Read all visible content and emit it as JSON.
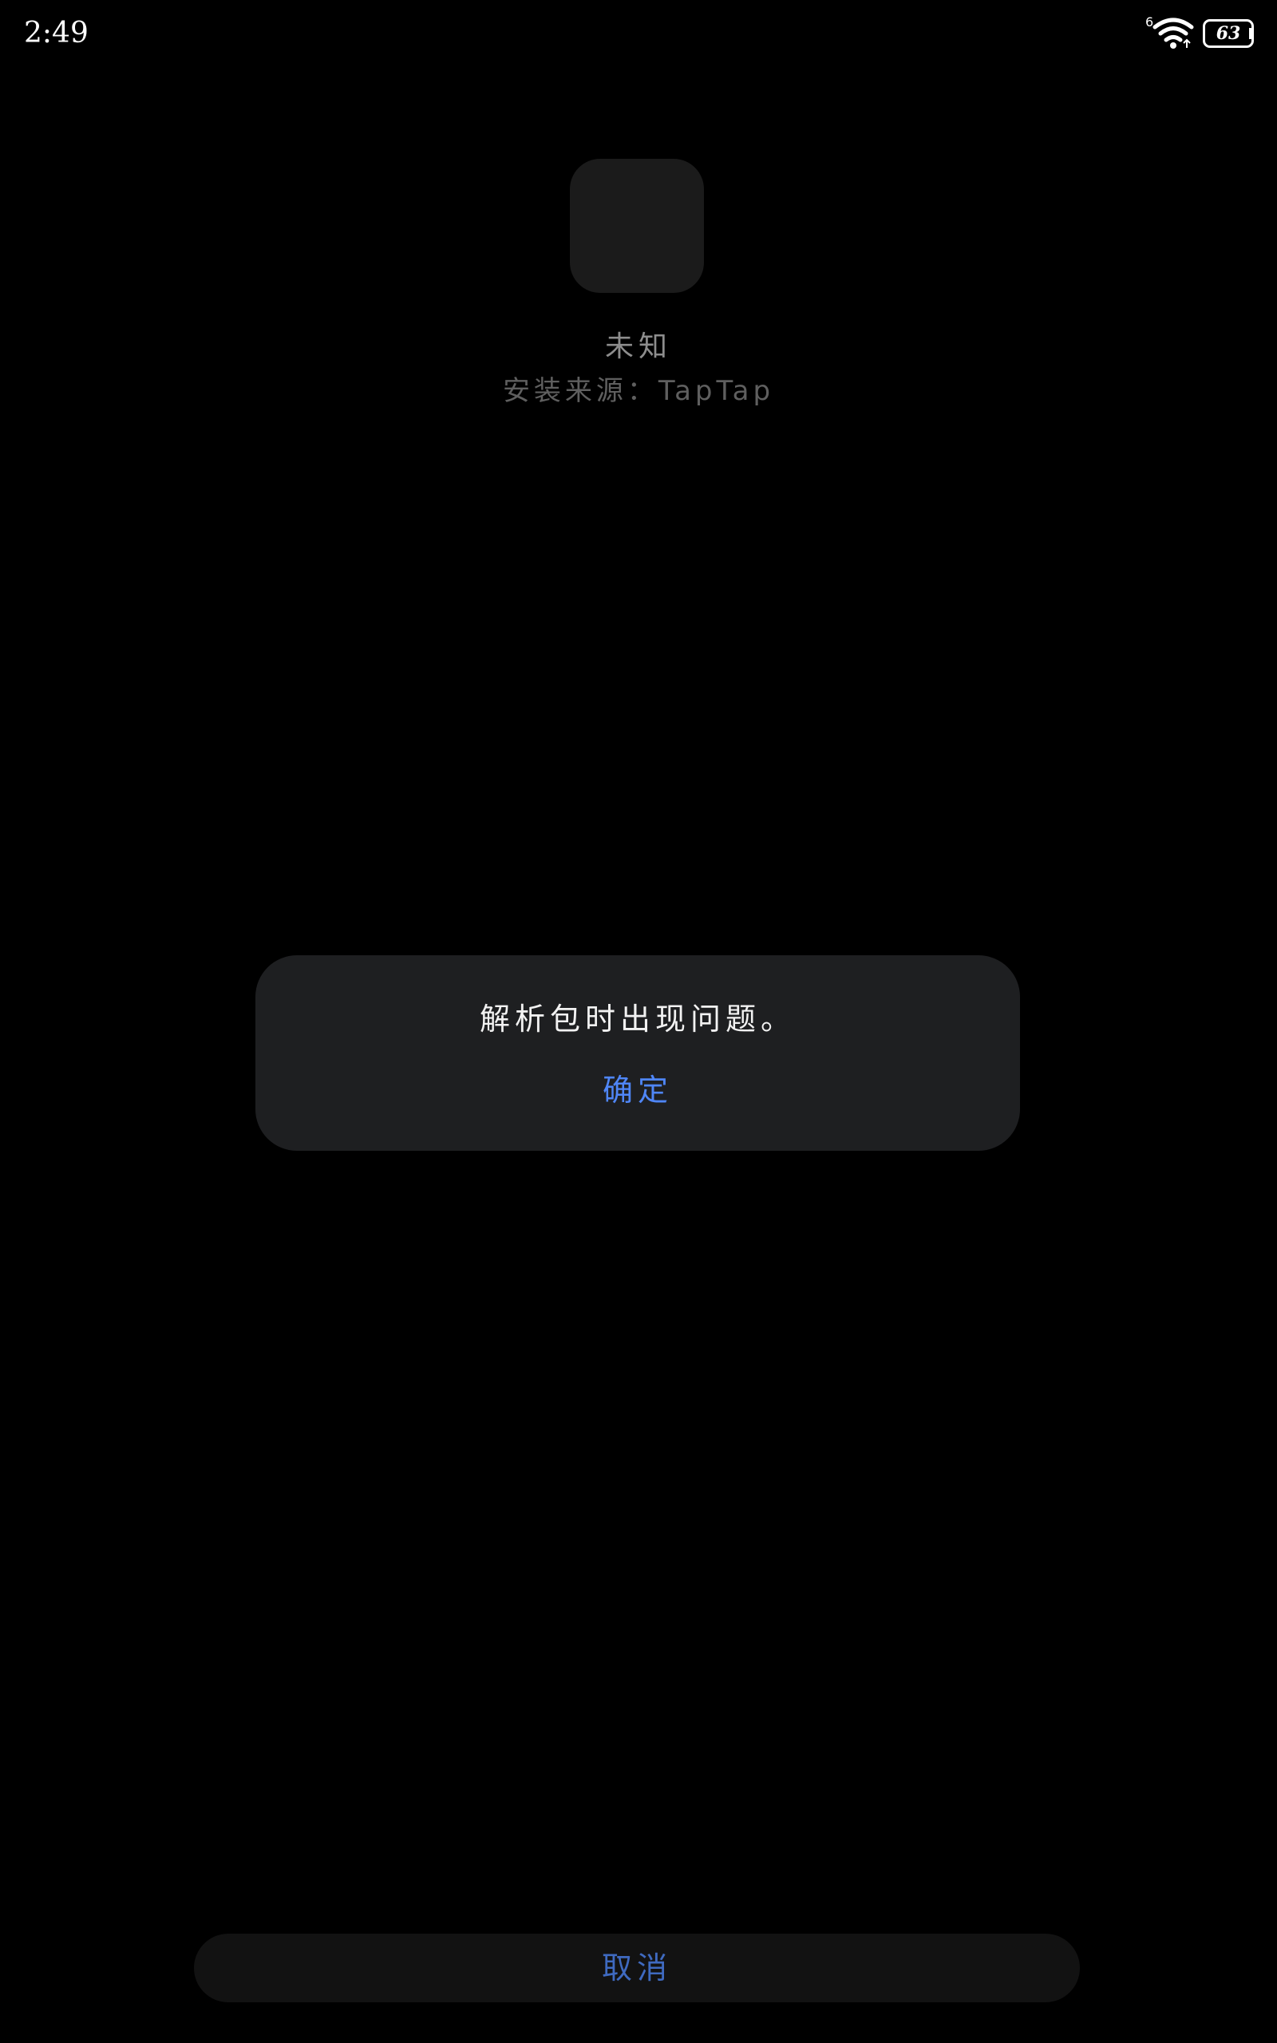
{
  "status_bar": {
    "time": "2:49",
    "wifi_label": "6",
    "battery_level": "63"
  },
  "app": {
    "name": "未知",
    "install_source": "安装来源：TapTap"
  },
  "dialog": {
    "message": "解析包时出现问题。",
    "confirm_label": "确定"
  },
  "footer": {
    "cancel_label": "取消"
  },
  "colors": {
    "background": "#000000",
    "dialog_bg": "#1e1f21",
    "accent_blue": "#4f86f7",
    "cancel_blue": "#3f6ac0"
  },
  "icons": [
    "wifi-icon",
    "battery-icon"
  ]
}
